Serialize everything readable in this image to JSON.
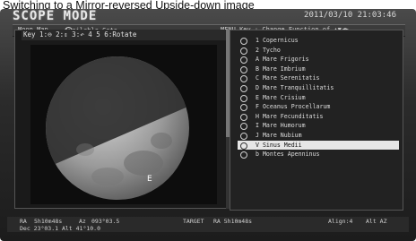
{
  "caption": "Switching to a Mirror-reversed Upside-down image",
  "screen": {
    "mode_title": "SCOPE MODE",
    "datetime": "2011/03/10 21:03:46"
  },
  "top_bar": {
    "moon_map": "Moon Map",
    "available_goto": "Available Goto",
    "menu_key": "MENU Key : Change Function of ▲▼◀▶"
  },
  "key_bar": {
    "text": "Key 1:⊖  2:⇕  3:↶  4 5 6:Rotate"
  },
  "moon_view": {
    "pointer_label": "E"
  },
  "targets": {
    "items": [
      "1 Copernicus",
      "2 Tycho",
      "A Mare Frigoris",
      "B Mare Imbrium",
      "C Mare Serenitatis",
      "D Mare Tranquillitatis",
      "E Mare Crisium",
      "F Oceanus Procellarum",
      "H Mare Fecunditatis",
      "I Mare Humorum",
      "J Mare Nubium",
      "V Sinus Medii",
      "b Montes Apenninus"
    ],
    "selected_index": 11
  },
  "status": {
    "ra_label": "RA",
    "ra_value": "5h10m48s",
    "az_label": "Az",
    "az_value": "093°03.5",
    "target_label": "TARGET",
    "target_ra": "RA 5h10m48s",
    "line2": "Dec 23°03.1   Alt 41°10.0",
    "align": "Align:4",
    "mode": "Alt AZ"
  }
}
